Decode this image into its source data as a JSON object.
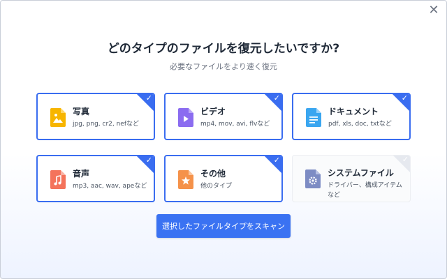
{
  "dialog": {
    "title": "どのタイプのファイルを復元したいですか?",
    "subtitle": "必要なファイルをより速く復元",
    "close_glyph": "✕",
    "scan_button": "選択したファイルタイプをスキャン"
  },
  "file_types": [
    {
      "label": "写真",
      "desc": "jpg, png, cr2, nefなど",
      "checked": true,
      "icon": "photo-icon",
      "color": "#f7b500"
    },
    {
      "label": "ビデオ",
      "desc": "mp4, mov, avi, flvなど",
      "checked": true,
      "icon": "video-icon",
      "color": "#8b6cf0"
    },
    {
      "label": "ドキュメント",
      "desc": "pdf, xls, doc, txtなど",
      "checked": true,
      "icon": "document-icon",
      "color": "#3aa6f0"
    },
    {
      "label": "音声",
      "desc": "mp3, aac, wav, apeなど",
      "checked": true,
      "icon": "audio-icon",
      "color": "#f4735b"
    },
    {
      "label": "その他",
      "desc": "他のタイプ",
      "checked": true,
      "icon": "other-icon",
      "color": "#f5924a"
    },
    {
      "label": "システムファイル",
      "desc": "ドライバー、構成アイテムなど",
      "checked": false,
      "icon": "system-file-icon",
      "color": "#7d8cc4"
    }
  ],
  "check_glyph": "✓",
  "colors": {
    "accent": "#3a6df0"
  }
}
